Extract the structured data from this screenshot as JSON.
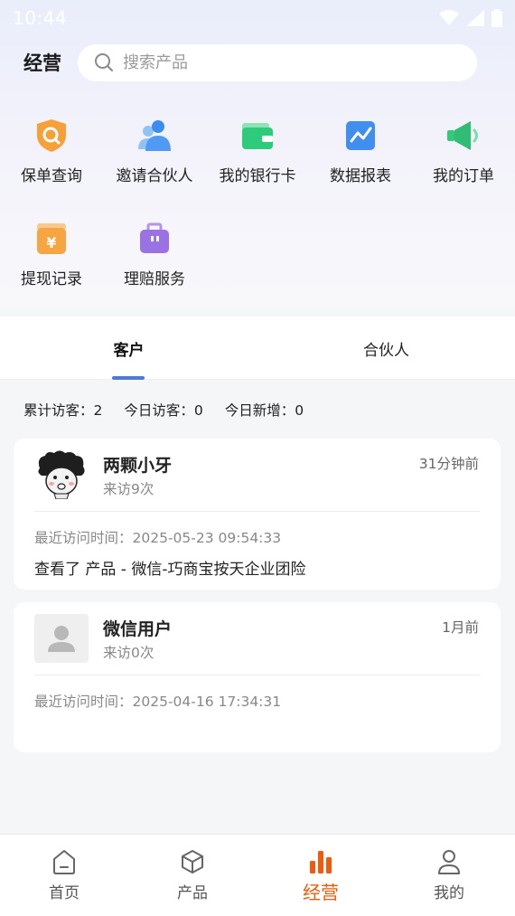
{
  "status_bar": {
    "time": "10:44"
  },
  "header": {
    "title": "经营",
    "search_placeholder": "搜索产品"
  },
  "quick_actions": [
    {
      "label": "保单查询",
      "icon": "shield-search-icon"
    },
    {
      "label": "邀请合伙人",
      "icon": "people-icon"
    },
    {
      "label": "我的银行卡",
      "icon": "wallet-icon"
    },
    {
      "label": "数据报表",
      "icon": "chart-icon"
    },
    {
      "label": "我的订单",
      "icon": "megaphone-icon"
    },
    {
      "label": "提现记录",
      "icon": "yuan-icon"
    },
    {
      "label": "理赔服务",
      "icon": "briefcase-icon"
    }
  ],
  "tabs": [
    {
      "label": "客户",
      "active": true
    },
    {
      "label": "合伙人",
      "active": false
    }
  ],
  "stats": {
    "total_visitors": "累计访客：2",
    "today_visitors": "今日访客：0",
    "today_new": "今日新增：0"
  },
  "customers": [
    {
      "name": "两颗小牙",
      "visits": "来访9次",
      "ago": "31分钟前",
      "last_visit": "最近访问时间：2025-05-23 09:54:33",
      "viewed": "查看了 产品 - 微信-巧商宝按天企业团险"
    },
    {
      "name": "微信用户",
      "visits": "来访0次",
      "ago": "1月前",
      "last_visit": "最近访问时间：2025-04-16 17:34:31",
      "viewed": ""
    }
  ],
  "bottom_nav": [
    {
      "label": "首页",
      "icon": "home-icon",
      "active": false
    },
    {
      "label": "产品",
      "icon": "box-icon",
      "active": false
    },
    {
      "label": "经营",
      "icon": "bar-chart-icon",
      "active": true
    },
    {
      "label": "我的",
      "icon": "user-icon",
      "active": false
    }
  ],
  "colors": {
    "accent": "#f05a0a",
    "tab_indicator": "#4d7ad6"
  }
}
